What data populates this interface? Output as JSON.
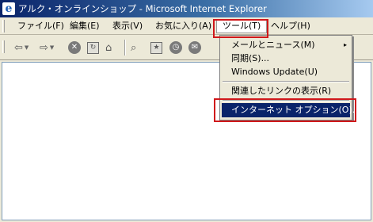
{
  "window": {
    "title": "アルク・オンラインショップ - Microsoft Internet Explorer",
    "icon": "ie-logo-icon"
  },
  "menubar": {
    "items": [
      {
        "label": "ファイル(F)"
      },
      {
        "label": "編集(E)"
      },
      {
        "label": "表示(V)"
      },
      {
        "label": "お気に入り(A)"
      },
      {
        "label": "ツール(T)"
      },
      {
        "label": "ヘルプ(H)"
      }
    ],
    "active_index": 4
  },
  "toolbar": {
    "icons": [
      "back-arrow-icon",
      "forward-arrow-icon",
      "stop-icon",
      "refresh-icon",
      "home-icon",
      "search-icon",
      "favorites-icon",
      "history-icon",
      "mail-icon"
    ]
  },
  "tools_menu": {
    "items": [
      {
        "label": "メールとニュース(M)",
        "has_submenu": true
      },
      {
        "label": "同期(S)..."
      },
      {
        "label": "Windows Update(U)"
      },
      {
        "label": "関連したリンクの表示(R)"
      },
      {
        "label": "インターネット オプション(O)...",
        "selected": true
      }
    ],
    "submenu_arrow": "▸"
  },
  "colors": {
    "highlight": "#d0181b",
    "selection": "#0a246a",
    "titlebar": "#0a246a"
  }
}
